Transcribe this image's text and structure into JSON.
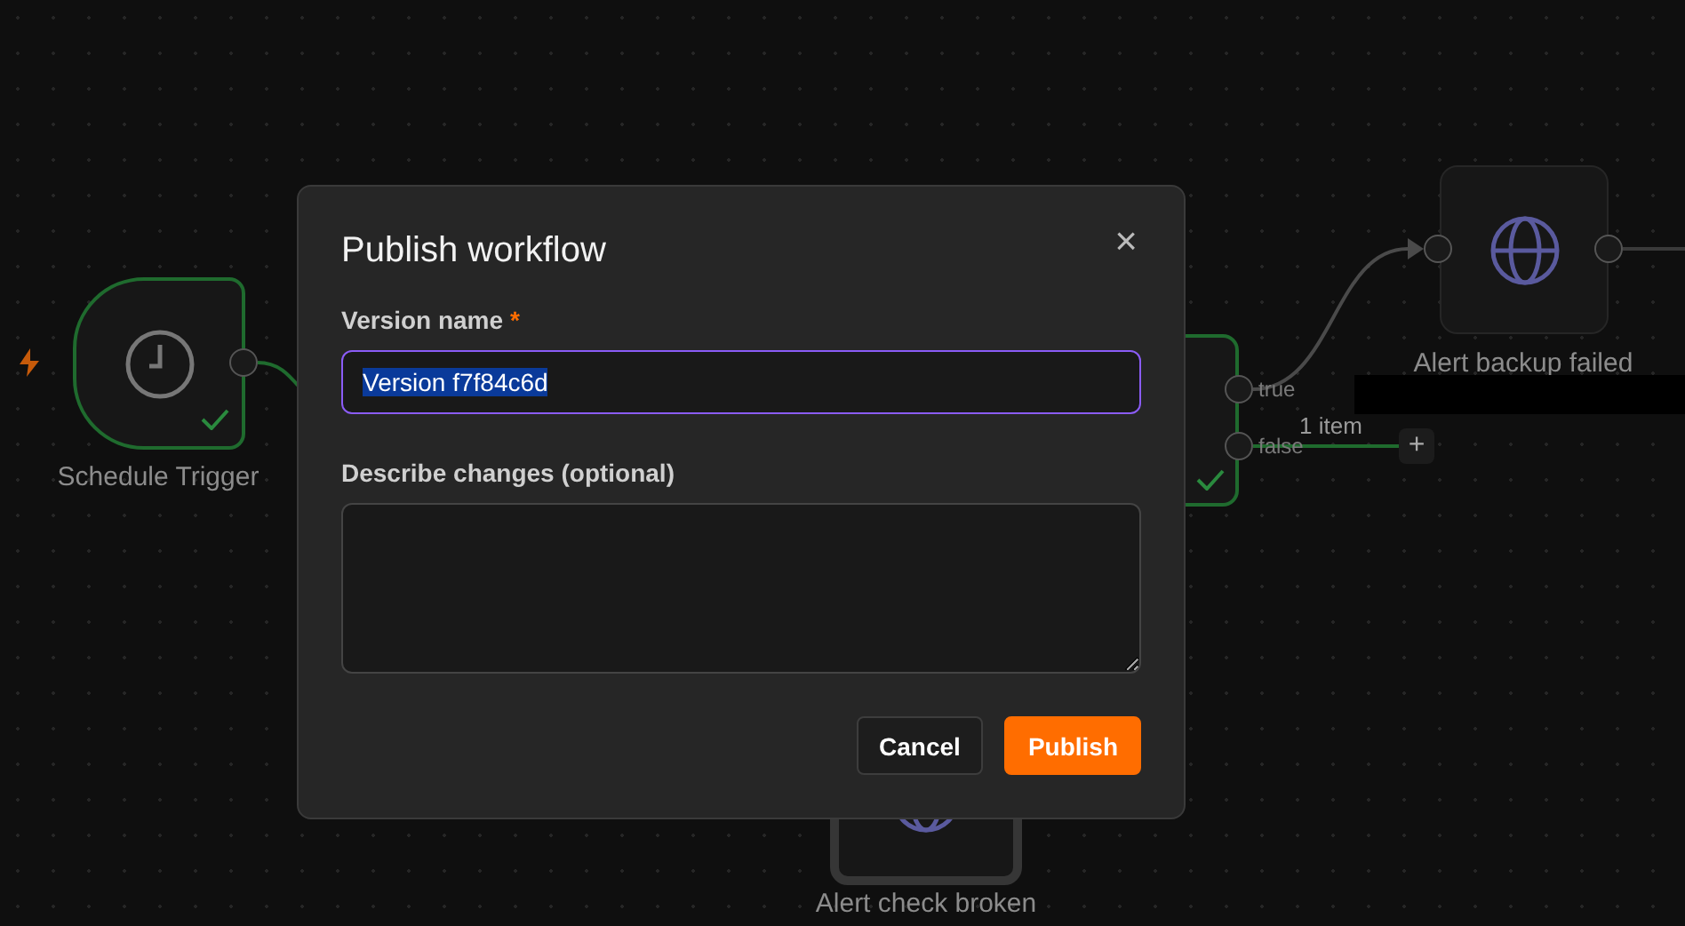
{
  "canvas": {
    "nodes": [
      {
        "kind": "trigger",
        "label": "Schedule Trigger",
        "success": true
      },
      {
        "kind": "if",
        "success": true,
        "outputs": [
          "true",
          "false"
        ]
      },
      {
        "kind": "http",
        "label": "Alert backup failed",
        "success": false
      },
      {
        "kind": "http",
        "label": "Alert check broken",
        "success": false
      }
    ],
    "edge_label": "1 item",
    "add_button": "+"
  },
  "dialog": {
    "title": "Publish workflow",
    "close": "×",
    "version_field": {
      "label": "Version name",
      "required_mark": "*",
      "value": "Version f7f84c6d",
      "text_selected": true,
      "focused": true
    },
    "description_field": {
      "label": "Describe changes (optional)"
    },
    "buttons": [
      {
        "kind": "secondary",
        "label": "Cancel"
      },
      {
        "kind": "primary",
        "label": "Publish"
      }
    ]
  }
}
